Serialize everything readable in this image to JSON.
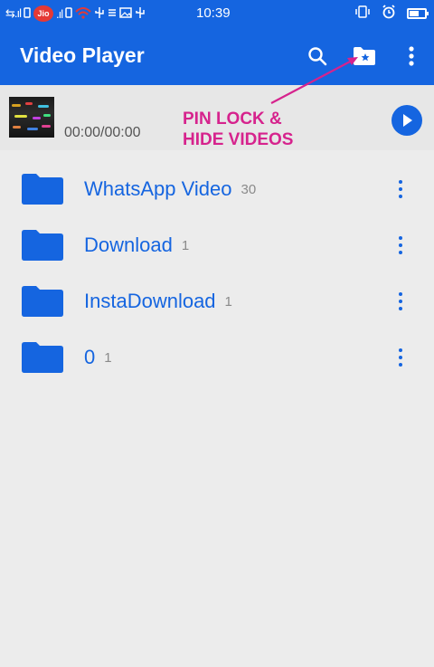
{
  "status_bar": {
    "left_glyphs": "⇆.ıl",
    "left_glyphs_2": ".ıl",
    "jio_label": "Jio",
    "time": "10:39"
  },
  "app_bar": {
    "title": "Video Player",
    "icons": [
      "search-icon",
      "folder-star-icon",
      "more-vert-icon"
    ]
  },
  "now_playing": {
    "time": "00:00/00:00"
  },
  "annotation": {
    "line1": "PIN LOCK &",
    "line2": "HIDE VIDEOS",
    "color": "#d6238d"
  },
  "folders": [
    {
      "name": "WhatsApp Video",
      "count": "30"
    },
    {
      "name": "Download",
      "count": "1"
    },
    {
      "name": "InstaDownload",
      "count": "1"
    },
    {
      "name": "0",
      "count": "1"
    }
  ],
  "colors": {
    "primary": "#1565e0",
    "background": "#ececec",
    "muted": "#8a8a8a"
  }
}
